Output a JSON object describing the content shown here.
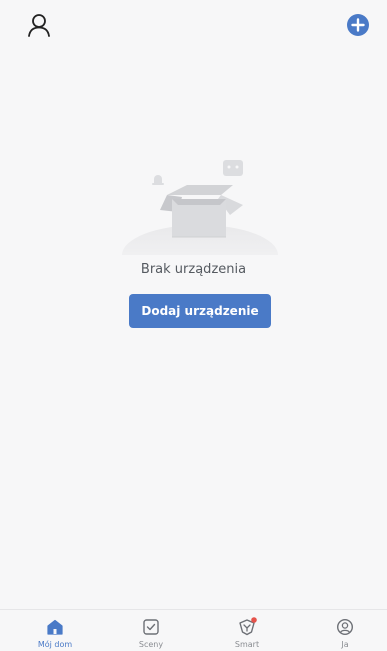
{
  "header": {
    "profile_icon": "person-outline-icon",
    "add_icon": "plus-circle-icon",
    "accent_color": "#4a7ac7"
  },
  "empty_state": {
    "illustration": "empty-box-icon",
    "message": "Brak urządzenia",
    "button_label": "Dodaj urządzenie"
  },
  "tab_bar": {
    "active_color": "#4a7ac7",
    "inactive_color": "#8a8d92",
    "badge_color": "#e5534b",
    "tabs": [
      {
        "label": "Mój dom",
        "icon": "home-icon",
        "active": true
      },
      {
        "label": "Sceny",
        "icon": "checkbox-icon",
        "active": false
      },
      {
        "label": "Smart",
        "icon": "smart-shield-icon",
        "active": false,
        "badge": true
      },
      {
        "label": "Ja",
        "icon": "user-circle-icon",
        "active": false
      }
    ]
  }
}
